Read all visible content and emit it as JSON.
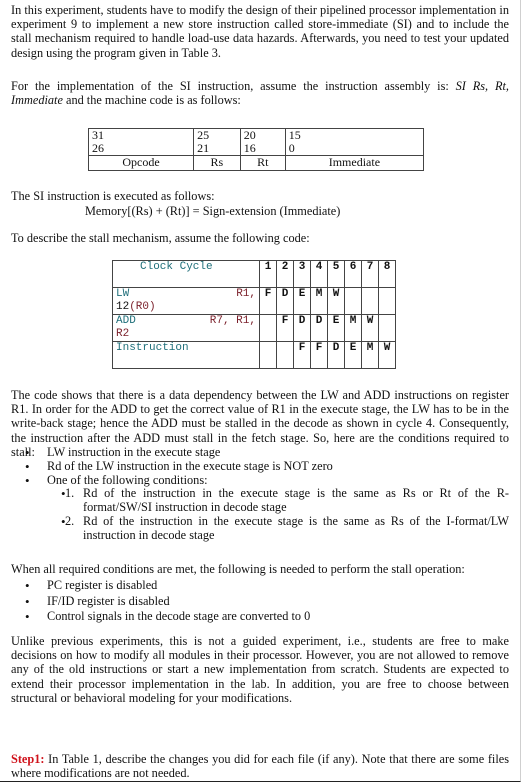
{
  "intro_paragraph": "In this experiment, students have to modify the design of their pipelined processor implementation in experiment 9 to implement a new store instruction called store-immediate (SI) and to include the stall mechanism required to handle load-use data hazards. Afterwards, you need to test your updated design using the program given in Table 3.",
  "si_intro": {
    "prefix": "For the implementation of the SI instruction, assume the instruction assembly is: ",
    "assembly": "SI Rs, Rt, Immediate",
    "suffix": " and the machine code is as follows:"
  },
  "machine_code_table": {
    "fields": [
      {
        "bit_high": "31",
        "bit_low": "26",
        "name": "Opcode"
      },
      {
        "bit_high": "25",
        "bit_low": "21",
        "name": "Rs"
      },
      {
        "bit_high": "20",
        "bit_low": "16",
        "name": "Rt"
      },
      {
        "bit_high": "15",
        "bit_low": "0",
        "name": "Immediate"
      }
    ]
  },
  "si_exec_label": "The SI instruction is executed as follows:",
  "si_exec_formula": "Memory[(Rs) + (Rt)] = Sign-extension (Immediate)",
  "stall_intro": "To describe the stall mechanism, assume the following code:",
  "pipeline_table": {
    "header_label": "Clock Cycle",
    "cycles": [
      "1",
      "2",
      "3",
      "4",
      "5",
      "6",
      "7",
      "8"
    ],
    "rows": [
      {
        "op": "LW",
        "operands_line1": "R1,",
        "operands_line2_num": "12",
        "operands_line2_reg": "(R0)",
        "stages": [
          "F",
          "D",
          "E",
          "M",
          "W",
          "",
          "",
          ""
        ]
      },
      {
        "op": "ADD",
        "operands_line1": "R7, R1,",
        "operands_line2_num": "",
        "operands_line2_reg": "R2",
        "stages": [
          "",
          "F",
          "D",
          "D",
          "E",
          "M",
          "W",
          ""
        ]
      },
      {
        "op": "Instruction",
        "operands_line1": "",
        "operands_line2_num": "",
        "operands_line2_reg": "",
        "stages": [
          "",
          "",
          "F",
          "F",
          "D",
          "E",
          "M",
          "W"
        ]
      }
    ]
  },
  "dependency_paragraph": "The code shows that there is a data dependency between the LW and ADD instructions on register R1. In order for the ADD to get the correct value of R1 in the execute stage, the LW has to be in the write-back stage; hence the ADD must be stalled in the decode as shown in cycle 4. Consequently, the instruction after the ADD must stall in the fetch stage. So, here are the conditions required to stall:",
  "stall_conditions": [
    "LW instruction in the execute stage",
    "Rd of the LW instruction in the execute stage is NOT zero",
    "One of the following conditions:"
  ],
  "sub_conditions": [
    {
      "num": "1.",
      "text": "Rd of the instruction in the execute stage is the same as Rs or Rt of the R-format/SW/SI instruction in decode stage"
    },
    {
      "num": "2.",
      "text": "Rd of the instruction in the execute stage is the same as Rs of the I-format/LW instruction in decode stage"
    }
  ],
  "stall_ops_intro": "When all required conditions are met, the following is needed to perform the stall operation:",
  "stall_ops": [
    "PC register is disabled",
    "IF/ID register is disabled",
    "Control signals in the decode stage are converted to 0"
  ],
  "freedom_paragraph": "Unlike previous experiments, this is not a guided experiment, i.e., students are free to make decisions on how to modify all modules in their processor. However, you are not allowed to remove any of the old instructions or start a new implementation from scratch. Students are expected to extend their processor implementation in the lab. In addition, you are free to choose between structural or behavioral modeling for your modifications.",
  "step1": {
    "label": "Step1:",
    "text": " In Table 1, describe the changes you did for each file (if any). Note that there are some files where modifications are not needed."
  },
  "colors": {
    "step_label": "#d0121b",
    "code_keyword": "#1f6f7a",
    "code_register": "#7a1f2a"
  }
}
